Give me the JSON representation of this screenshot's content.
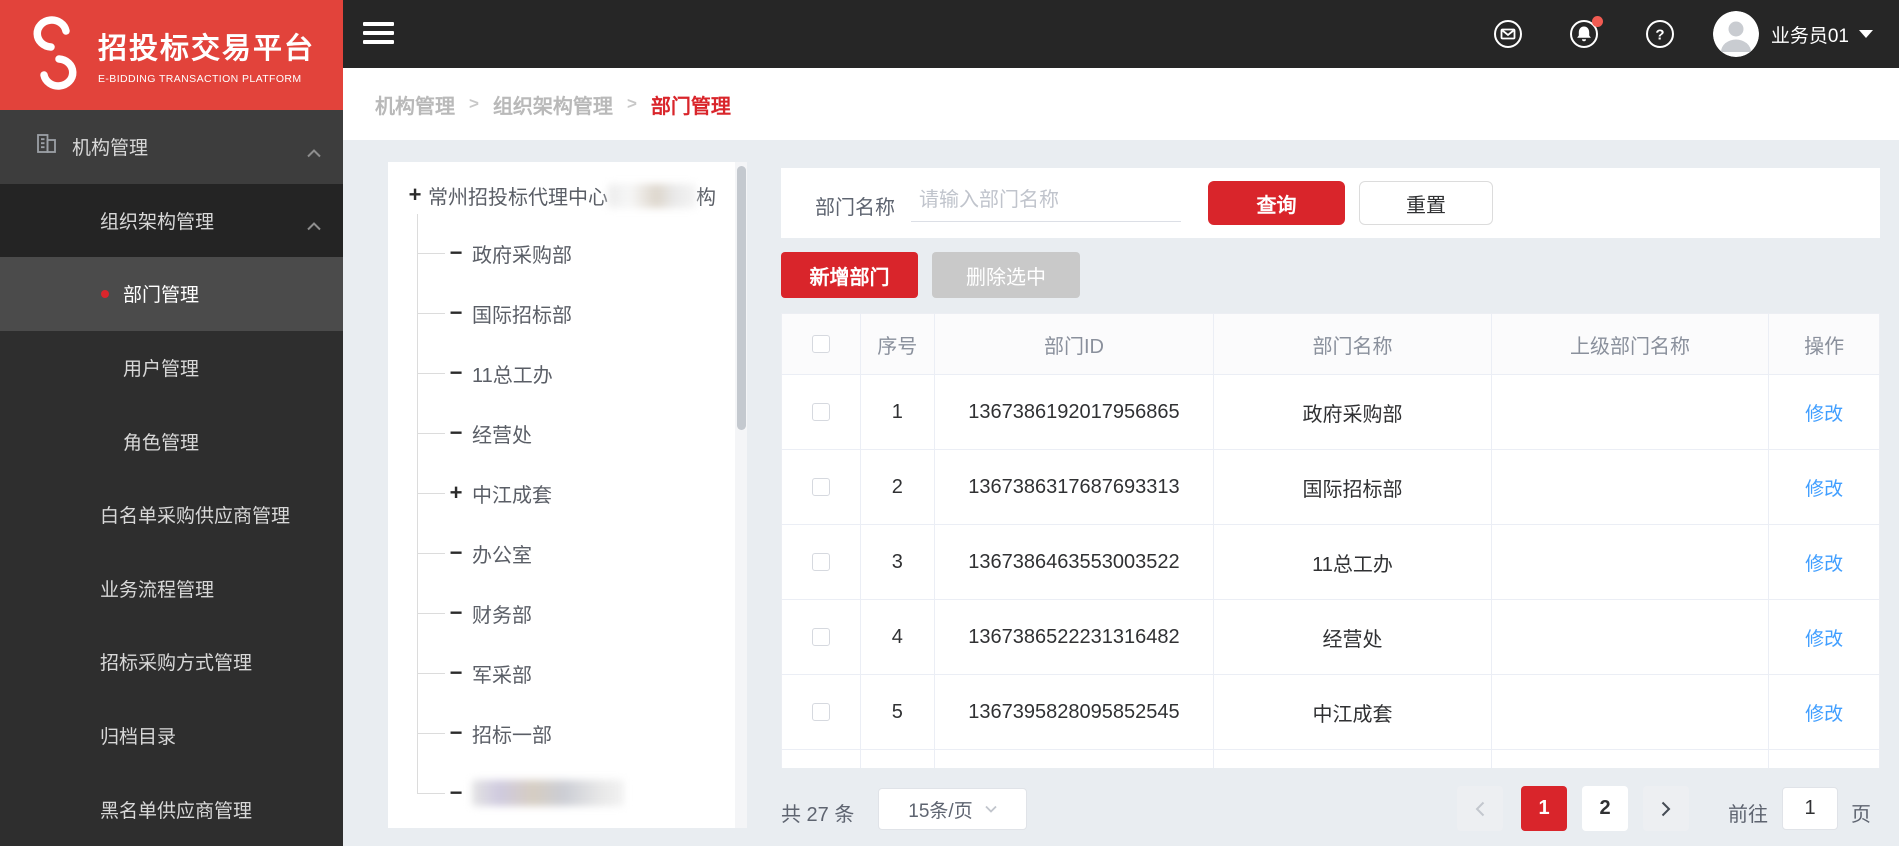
{
  "brand": {
    "title": "招投标交易平台",
    "subtitle": "E-BIDDING TRANSACTION PLATFORM"
  },
  "topbar": {
    "username": "业务员01"
  },
  "breadcrumb": {
    "item1": "机构管理",
    "item2": "组织架构管理",
    "item3": "部门管理",
    "separator": ">"
  },
  "sidebar": {
    "items": [
      {
        "label": "机构管理"
      },
      {
        "label": "组织架构管理"
      },
      {
        "label": "部门管理"
      },
      {
        "label": "用户管理"
      },
      {
        "label": "角色管理"
      },
      {
        "label": "白名单采购供应商管理"
      },
      {
        "label": "业务流程管理"
      },
      {
        "label": "招标采购方式管理"
      },
      {
        "label": "归档目录"
      },
      {
        "label": "黑名单供应商管理"
      }
    ]
  },
  "tree": {
    "root_toggle": "+",
    "root_prefix": "常州招投标代理中心",
    "root_suffix": "构",
    "children": [
      {
        "toggle": "−",
        "label": "政府采购部"
      },
      {
        "toggle": "−",
        "label": "国际招标部"
      },
      {
        "toggle": "−",
        "label": "11总工办"
      },
      {
        "toggle": "−",
        "label": "经营处"
      },
      {
        "toggle": "+",
        "label": "中江成套"
      },
      {
        "toggle": "−",
        "label": "办公室"
      },
      {
        "toggle": "−",
        "label": "财务部"
      },
      {
        "toggle": "−",
        "label": "军采部"
      },
      {
        "toggle": "−",
        "label": "招标一部"
      },
      {
        "toggle": "−",
        "label": ""
      }
    ]
  },
  "search": {
    "label": "部门名称",
    "placeholder": "请输入部门名称",
    "query": "查询",
    "reset": "重置"
  },
  "actions": {
    "add": "新增部门",
    "remove": "删除选中"
  },
  "table": {
    "col_no": "序号",
    "col_id": "部门ID",
    "col_name": "部门名称",
    "col_parent": "上级部门名称",
    "col_action": "操作",
    "rows": [
      {
        "no": "1",
        "id": "1367386192017956865",
        "name": "政府采购部",
        "parent": "",
        "action": "修改"
      },
      {
        "no": "2",
        "id": "1367386317687693313",
        "name": "国际招标部",
        "parent": "",
        "action": "修改"
      },
      {
        "no": "3",
        "id": "1367386463553003522",
        "name": "11总工办",
        "parent": "",
        "action": "修改"
      },
      {
        "no": "4",
        "id": "1367386522231316482",
        "name": "经营处",
        "parent": "",
        "action": "修改"
      },
      {
        "no": "5",
        "id": "1367395828095852545",
        "name": "中江成套",
        "parent": "",
        "action": "修改"
      }
    ]
  },
  "pagination": {
    "total": "共 27 条",
    "page_size": "15条/页",
    "page1": "1",
    "page2": "2",
    "active_page": "1",
    "goto_label": "前往",
    "goto_value": "1",
    "goto_unit": "页"
  },
  "colors": {
    "brand_red": "#D9252B",
    "logo_red": "#E2433B",
    "link_blue": "#409EFF",
    "topbar_dark": "#262626",
    "sidebar_dark": "#2E2E2E"
  }
}
